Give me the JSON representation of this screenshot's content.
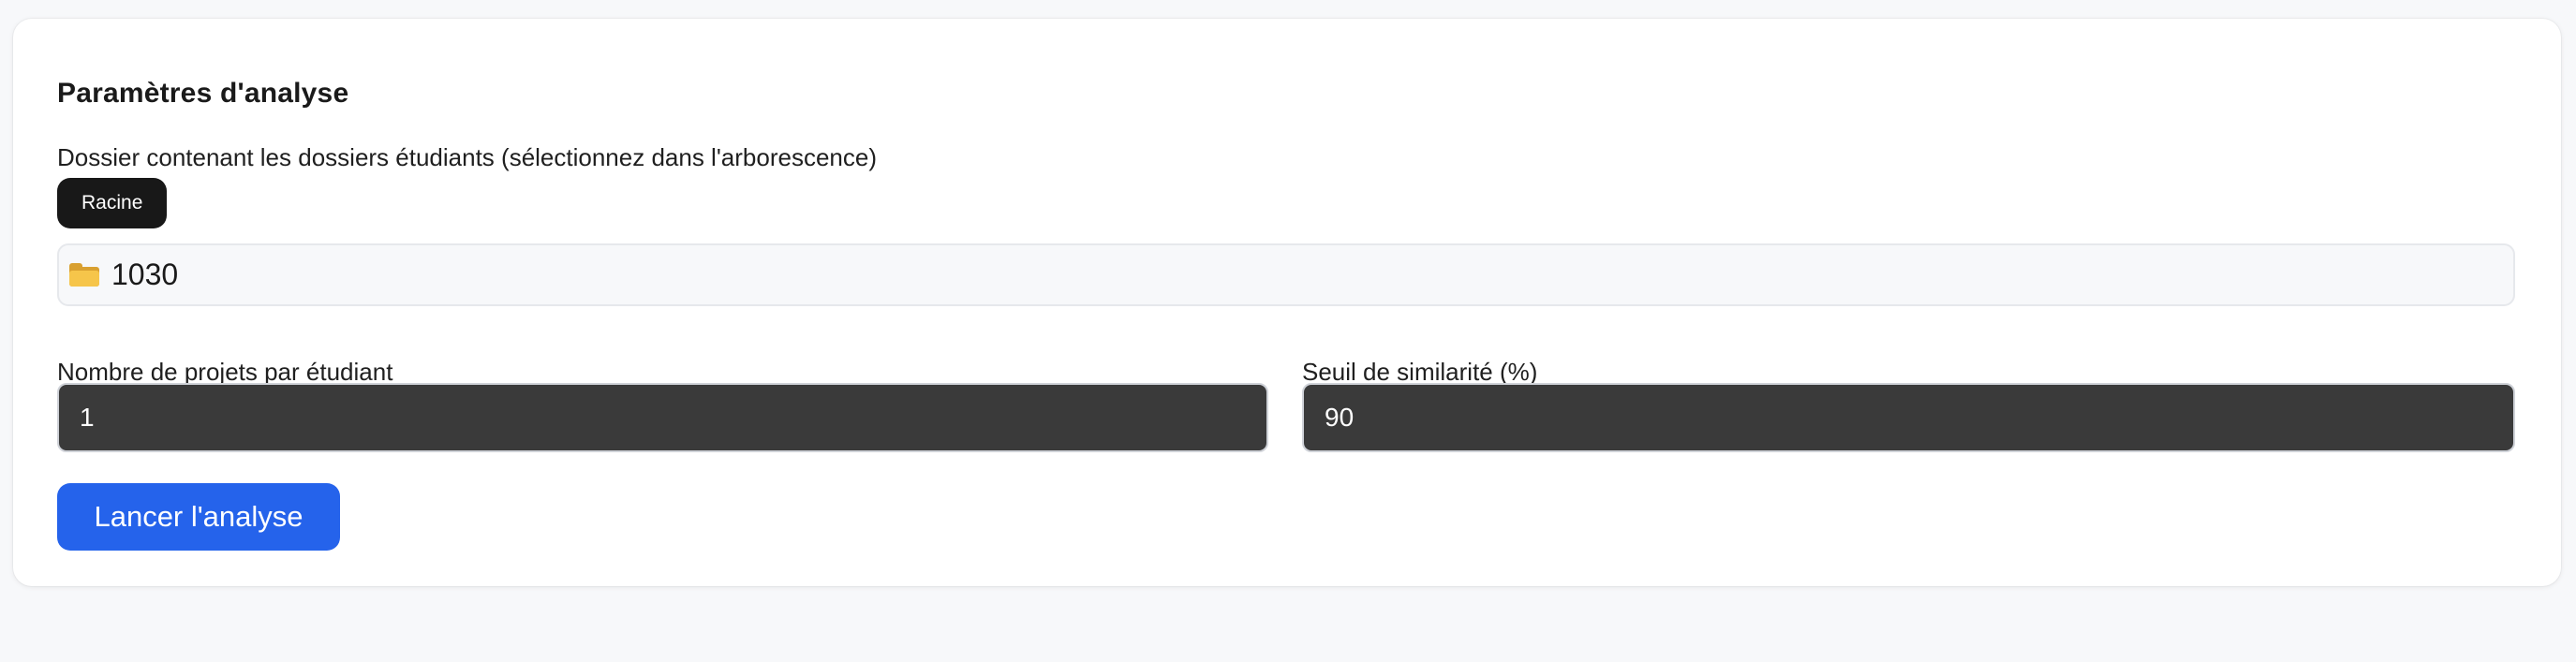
{
  "panel": {
    "title": "Paramètres d'analyse",
    "folder_label": "Dossier contenant les dossiers étudiants (sélectionnez dans l'arborescence)",
    "breadcrumb": [
      "Racine"
    ],
    "current_folder": "1030",
    "current_folder_icon": "folder-icon"
  },
  "fields": {
    "projects_label": "Nombre de projets par étudiant",
    "projects_value": "1",
    "threshold_label": "Seuil de similarité (%)",
    "threshold_value": "90"
  },
  "actions": {
    "launch_label": "Lancer l'analyse"
  },
  "colors": {
    "accent": "#2563eb",
    "breadcrumb_bg": "#181818",
    "input_bg": "#3a3a3a",
    "page_bg": "#f7f8fa"
  }
}
